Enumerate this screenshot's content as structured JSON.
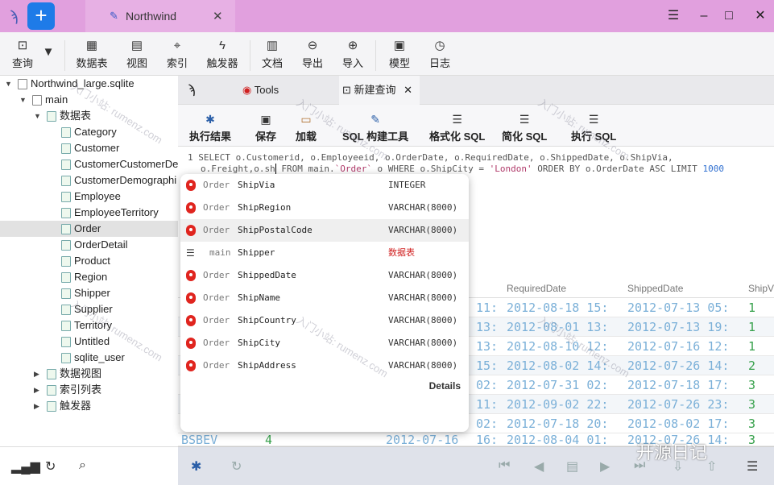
{
  "titlebar": {
    "tab_label": "Northwind",
    "close": "✕",
    "menu": "☰",
    "minimize": "–",
    "maximize": "□",
    "close_window": "✕"
  },
  "toolbar": [
    {
      "label": "查询",
      "icon": "query-icon",
      "glyph": "⊡"
    },
    {
      "label": "数据表",
      "icon": "table-icon",
      "glyph": "▦"
    },
    {
      "label": "视图",
      "icon": "view-icon",
      "glyph": "▤"
    },
    {
      "label": "索引",
      "icon": "index-icon",
      "glyph": "⌖"
    },
    {
      "label": "触发器",
      "icon": "trigger-icon",
      "glyph": "ϟ"
    },
    {
      "label": "文档",
      "icon": "document-icon",
      "glyph": "▥"
    },
    {
      "label": "导出",
      "icon": "export-icon",
      "glyph": "⊖"
    },
    {
      "label": "导入",
      "icon": "import-icon",
      "glyph": "⊕"
    },
    {
      "label": "模型",
      "icon": "model-icon",
      "glyph": "▣"
    },
    {
      "label": "日志",
      "icon": "log-icon",
      "glyph": "◷"
    }
  ],
  "tree": {
    "db": "Northwind_large.sqlite",
    "schema": "main",
    "tables_group": "数据表",
    "tables": [
      "Category",
      "Customer",
      "CustomerCustomerDe",
      "CustomerDemographi",
      "Employee",
      "EmployeeTerritory",
      "Order",
      "OrderDetail",
      "Product",
      "Region",
      "Shipper",
      "Supplier",
      "Territory",
      "Untitled",
      "sqlite_user"
    ],
    "selected": "Order",
    "groups": [
      "数据视图",
      "索引列表",
      "触发器"
    ]
  },
  "editor_tabs": {
    "tools": "Tools",
    "new_query": "新建查询",
    "close": "✕"
  },
  "query_toolbar": [
    {
      "label": "执行结果",
      "icon": "run-result-icon"
    },
    {
      "label": "保存",
      "icon": "save-icon"
    },
    {
      "label": "加载",
      "icon": "load-icon"
    },
    {
      "label": "SQL 构建工具",
      "icon": "sql-builder-icon"
    },
    {
      "label": "格式化 SQL",
      "icon": "format-sql-icon"
    },
    {
      "label": "简化 SQL",
      "icon": "simplify-sql-icon"
    },
    {
      "label": "执行 SQL",
      "icon": "run-sql-icon"
    }
  ],
  "editor": {
    "line_no": "1",
    "line1": "SELECT o.Customerid, o.Employeeid, o.OrderDate, o.RequiredDate, o.ShippedDate, o.ShipVia,",
    "line2_a": "o.Freight,o.sh",
    "line2_b": " FROM main.",
    "line2_str1": "`Order`",
    "line2_c": " o WHERE o.ShipCity = ",
    "line2_str2": "'London'",
    "line2_d": " ORDER BY o.OrderDate ASC LIMIT ",
    "line2_num": "1000"
  },
  "autocomplete": [
    {
      "table": "Order",
      "name": "ShipVia",
      "type": "INTEGER",
      "kind": "field"
    },
    {
      "table": "Order",
      "name": "ShipRegion",
      "type": "VARCHAR(8000)",
      "kind": "field"
    },
    {
      "table": "Order",
      "name": "ShipPostalCode",
      "type": "VARCHAR(8000)",
      "kind": "field"
    },
    {
      "table": "main",
      "name": "Shipper",
      "type": "数据表",
      "kind": "table"
    },
    {
      "table": "Order",
      "name": "ShippedDate",
      "type": "VARCHAR(8000)",
      "kind": "field"
    },
    {
      "table": "Order",
      "name": "ShipName",
      "type": "VARCHAR(8000)",
      "kind": "field"
    },
    {
      "table": "Order",
      "name": "ShipCountry",
      "type": "VARCHAR(8000)",
      "kind": "field"
    },
    {
      "table": "Order",
      "name": "ShipCity",
      "type": "VARCHAR(8000)",
      "kind": "field"
    },
    {
      "table": "Order",
      "name": "ShipAddress",
      "type": "VARCHAR(8000)",
      "kind": "field"
    }
  ],
  "details_label": "Details",
  "results": {
    "headers": [
      "RequiredDate",
      "ShippedDate",
      "ShipV"
    ],
    "rows": [
      [
        "11:",
        "2012-08-18 15:",
        "2012-07-13 05:",
        "1"
      ],
      [
        "13:",
        "2012-08-01 13:",
        "2012-07-13 19:",
        "1"
      ],
      [
        "13:",
        "2012-08-10 12:",
        "2012-07-16 12:",
        "1"
      ],
      [
        "15:",
        "2012-08-02 14:",
        "2012-07-26 14:",
        "2"
      ],
      [
        "02:",
        "2012-07-31 02:",
        "2012-07-18 17:",
        "3"
      ],
      [
        "11:",
        "2012-09-02 22:",
        "2012-07-26 23:",
        "3"
      ],
      [
        "02:",
        "2012-07-18 20:",
        "2012-08-02 17:",
        "3"
      ]
    ],
    "last_row": [
      "BSBEV",
      "4",
      "2012-07-16",
      "16:",
      "2012-08-04 01:",
      "2012-07-26 14:",
      "3"
    ]
  },
  "watermark": "入门小站: rumenz.com",
  "brand": "开源日记"
}
